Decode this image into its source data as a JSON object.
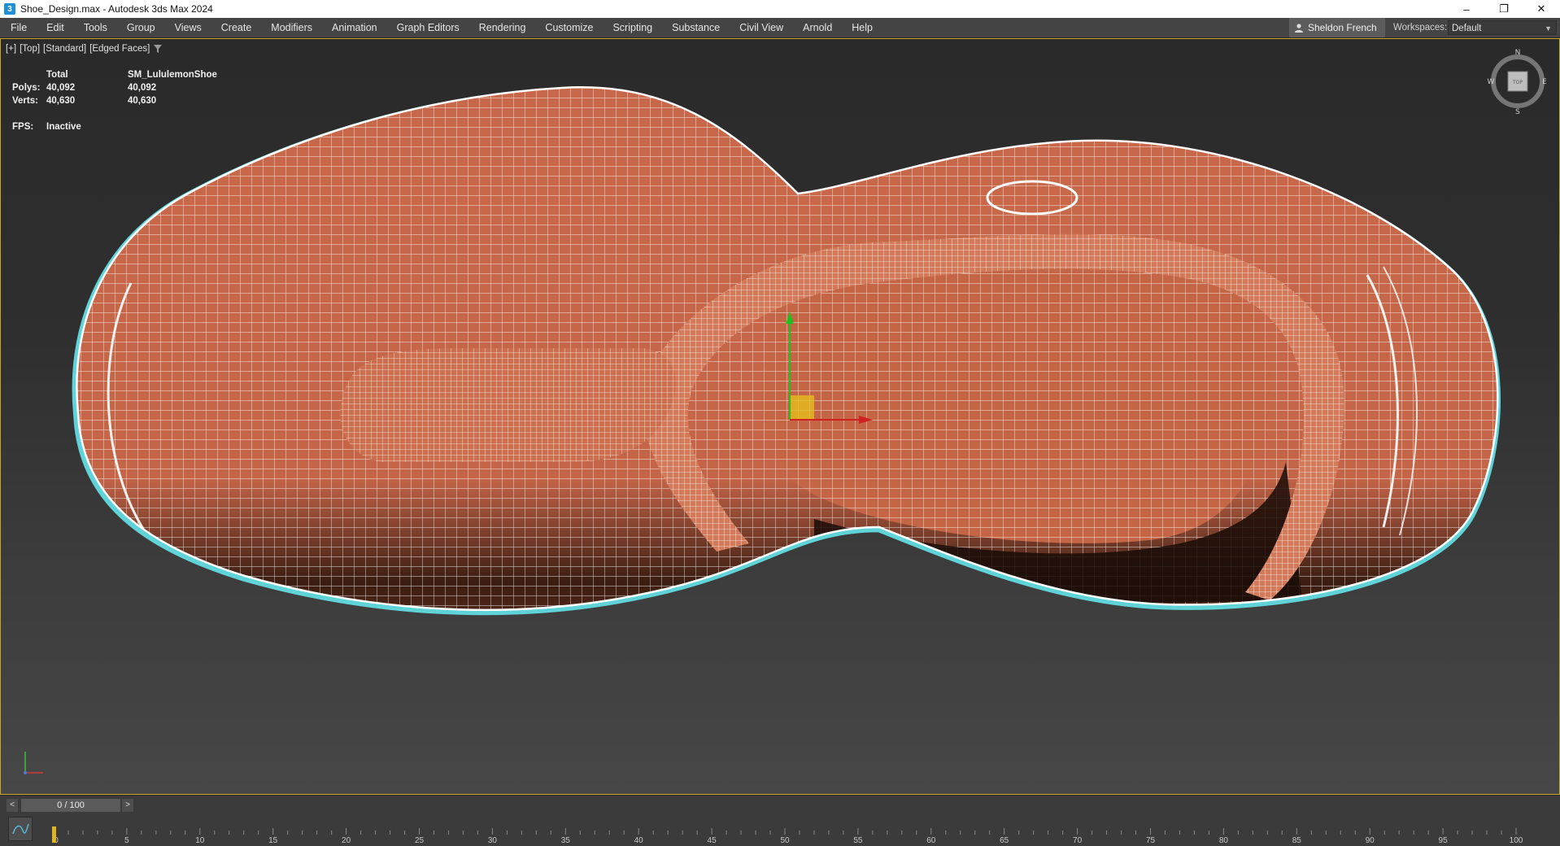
{
  "window": {
    "title": "Shoe_Design.max - Autodesk 3ds Max 2024",
    "app_icon_glyph": "3",
    "controls": {
      "minimize": "–",
      "restore": "❐",
      "close": "✕"
    }
  },
  "menu": {
    "items": [
      "File",
      "Edit",
      "Tools",
      "Group",
      "Views",
      "Create",
      "Modifiers",
      "Animation",
      "Graph Editors",
      "Rendering",
      "Customize",
      "Scripting",
      "Substance",
      "Civil View",
      "Arnold",
      "Help"
    ],
    "user": "Sheldon French",
    "workspaces_label": "Workspaces:",
    "workspace_value": "Default"
  },
  "viewport": {
    "label_plus": "[+]",
    "label_view": "[Top]",
    "label_shading": "[Standard]",
    "label_mode": "[Edged Faces]",
    "stats": {
      "header_total": "Total",
      "header_object": "SM_LululemonShoe",
      "polys_label": "Polys:",
      "polys_total": "40,092",
      "polys_object": "40,092",
      "verts_label": "Verts:",
      "verts_total": "40,630",
      "verts_object": "40,630",
      "fps_label": "FPS:",
      "fps_value": "Inactive"
    },
    "viewcube": {
      "north": "N",
      "south": "S",
      "east": "E",
      "west": "W",
      "face": "TOP"
    },
    "colors": {
      "mesh_fill": "#c9694a",
      "wire": "#ffffff",
      "selection_outline": "#5fd3d8",
      "border_active": "#c8a62a"
    }
  },
  "timeline": {
    "frame_display": "0 / 100",
    "prev": "<",
    "next": ">",
    "ticks": [
      "0",
      "5",
      "10",
      "15",
      "20",
      "25",
      "30",
      "35",
      "40",
      "45",
      "50",
      "55",
      "60",
      "65",
      "70",
      "75",
      "80",
      "85",
      "90",
      "95",
      "100"
    ]
  }
}
